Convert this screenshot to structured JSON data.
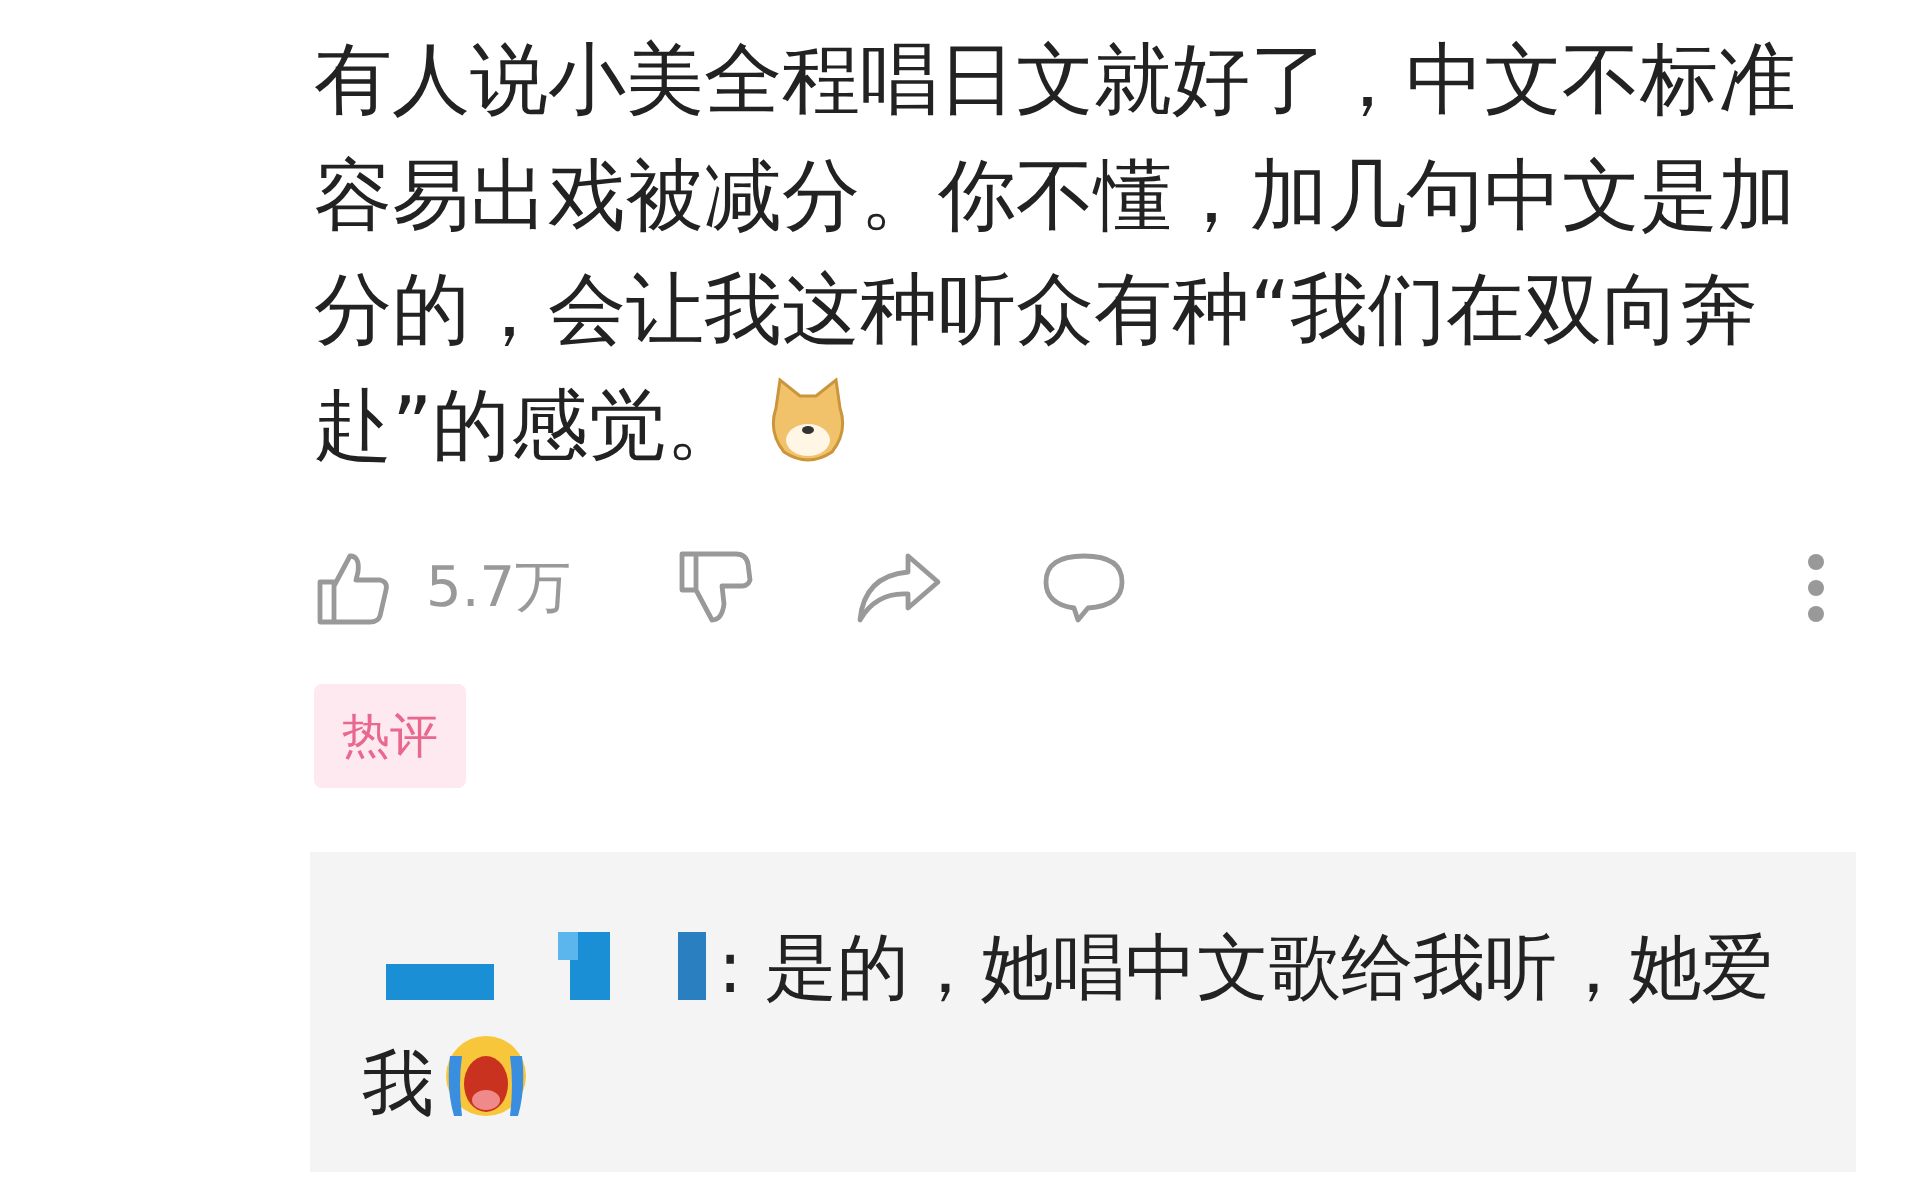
{
  "comment": {
    "text": "有人说小美全程唱日文就好了，中文不标准容易出戏被减分。你不懂，加几句中文是加分的，会让我这种听众有种“我们在双向奔赴”的感觉。",
    "emoji": {
      "kind": "dog"
    }
  },
  "actions": {
    "like_count": "5.7万"
  },
  "tag": "热评",
  "reply": {
    "author_redacted": true,
    "text": ": 是的，她唱中文歌给我听，她爱我",
    "emoji": {
      "kind": "crying"
    }
  }
}
